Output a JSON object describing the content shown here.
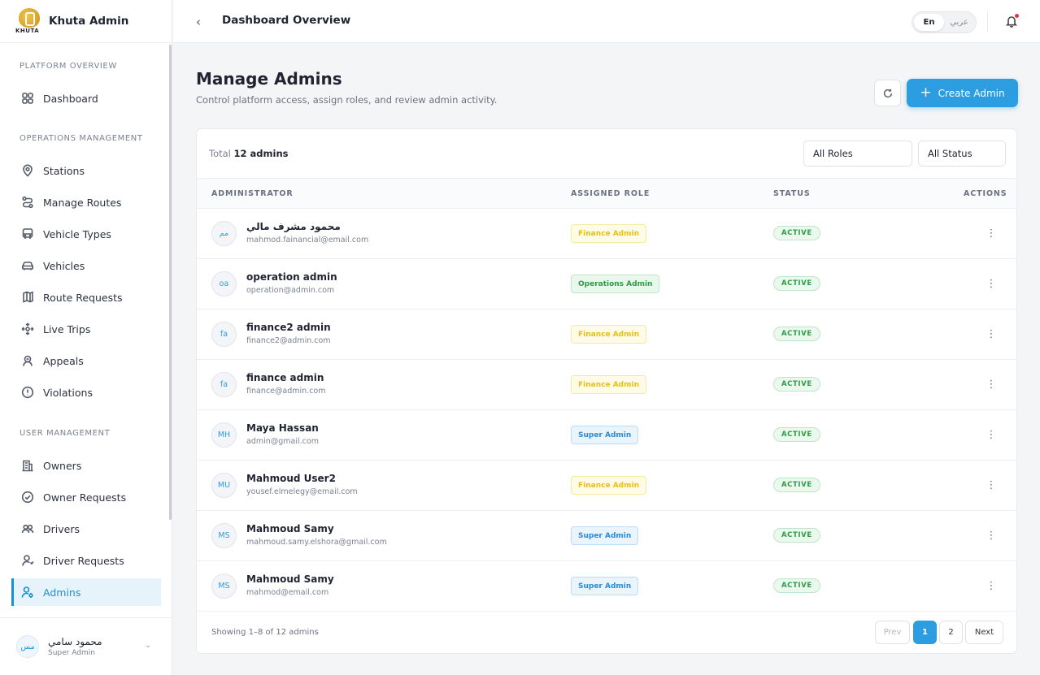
{
  "brand": {
    "logo_text": "KHUTA",
    "name": "Khuta Admin"
  },
  "sidebar": {
    "sections": [
      {
        "title": "PLATFORM OVERVIEW"
      },
      {
        "title": "OPERATIONS MANAGEMENT"
      },
      {
        "title": "USER MANAGEMENT"
      }
    ],
    "items": [
      {
        "label": "Dashboard",
        "icon": "grid-icon"
      },
      {
        "label": "Stations",
        "icon": "map-pin-icon"
      },
      {
        "label": "Manage Routes",
        "icon": "route-icon"
      },
      {
        "label": "Vehicle Types",
        "icon": "bus-icon"
      },
      {
        "label": "Vehicles",
        "icon": "car-icon"
      },
      {
        "label": "Route Requests",
        "icon": "route-request-icon"
      },
      {
        "label": "Live Trips",
        "icon": "live-trips-icon"
      },
      {
        "label": "Appeals",
        "icon": "appeals-icon"
      },
      {
        "label": "Violations",
        "icon": "alert-circle-icon"
      },
      {
        "label": "Owners",
        "icon": "building-icon"
      },
      {
        "label": "Owner Requests",
        "icon": "check-circle-icon"
      },
      {
        "label": "Drivers",
        "icon": "users-icon"
      },
      {
        "label": "Driver Requests",
        "icon": "user-request-icon"
      },
      {
        "label": "Admins",
        "icon": "user-gear-icon"
      }
    ],
    "active_item": "Admins",
    "user": {
      "initials": "مس",
      "name": "محمود سامي",
      "role": "Super Admin"
    }
  },
  "topbar": {
    "title": "Dashboard Overview",
    "lang_en": "En",
    "lang_ar": "عربي",
    "notification_dot_color": "#e53935"
  },
  "page": {
    "title": "Manage Admins",
    "subtitle": "Control platform access, assign roles, and review admin activity.",
    "create_label": "Create Admin",
    "accent_color": "#2b9de0"
  },
  "table": {
    "total_prefix": "Total",
    "total_value": "12 admins",
    "filters": {
      "roles": "All Roles",
      "status": "All Status"
    },
    "columns": [
      "ADMINISTRATOR",
      "ASSIGNED ROLE",
      "STATUS",
      "ACTIONS"
    ],
    "rows": [
      {
        "initials": "مم",
        "name": "محمود مشرف مالي",
        "email": "mahmod.fainancial@email.com",
        "role": "Finance Admin",
        "role_type": "finance",
        "status": "ACTIVE"
      },
      {
        "initials": "oa",
        "name": "operation admin",
        "email": "operation@admin.com",
        "role": "Operations Admin",
        "role_type": "operations",
        "status": "ACTIVE"
      },
      {
        "initials": "fa",
        "name": "finance2 admin",
        "email": "finance2@admin.com",
        "role": "Finance Admin",
        "role_type": "finance",
        "status": "ACTIVE"
      },
      {
        "initials": "fa",
        "name": "finance admin",
        "email": "finance@admin.com",
        "role": "Finance Admin",
        "role_type": "finance",
        "status": "ACTIVE"
      },
      {
        "initials": "MH",
        "name": "Maya Hassan",
        "email": "admin@gmail.com",
        "role": "Super Admin",
        "role_type": "super",
        "status": "ACTIVE"
      },
      {
        "initials": "MU",
        "name": "Mahmoud User2",
        "email": "yousef.elmelegy@email.com",
        "role": "Finance Admin",
        "role_type": "finance",
        "status": "ACTIVE"
      },
      {
        "initials": "MS",
        "name": "Mahmoud Samy",
        "email": "mahmoud.samy.elshora@gmail.com",
        "role": "Super Admin",
        "role_type": "super",
        "status": "ACTIVE"
      },
      {
        "initials": "MS",
        "name": "Mahmoud Samy",
        "email": "mahmod@email.com",
        "role": "Super Admin",
        "role_type": "super",
        "status": "ACTIVE"
      }
    ],
    "showing": "Showing 1–8 of 12 admins",
    "pagination": {
      "prev": "Prev",
      "pages": [
        "1",
        "2"
      ],
      "current": "1",
      "next": "Next"
    }
  }
}
